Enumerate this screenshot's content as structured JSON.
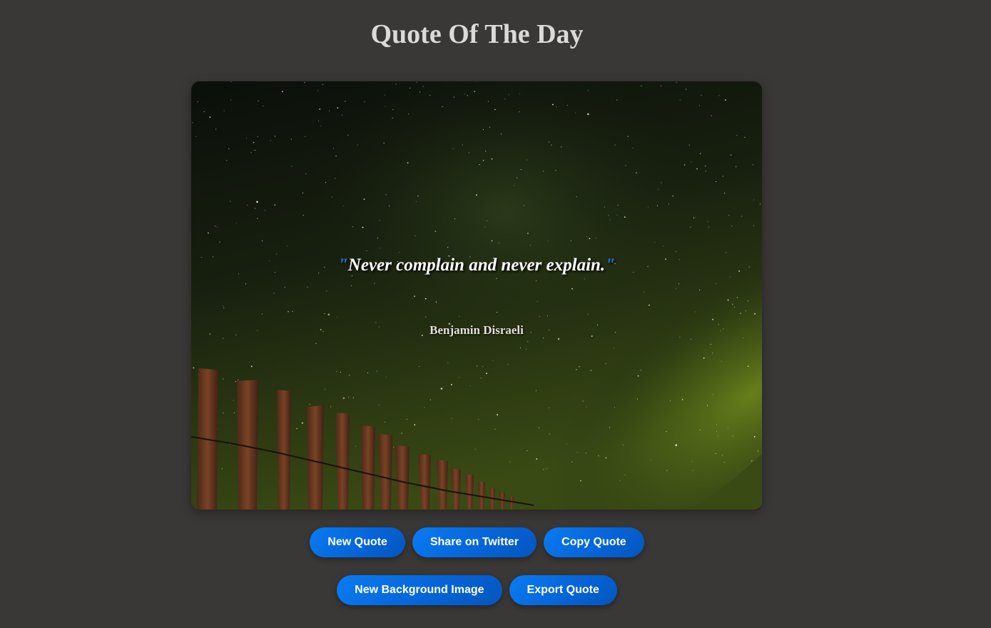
{
  "page": {
    "title": "Quote Of The Day"
  },
  "quote": {
    "open_mark": "\"",
    "text": "Never complain and never explain.",
    "close_mark": "\"",
    "author": "Benjamin Disraeli"
  },
  "buttons": {
    "new_quote": "New Quote",
    "share_twitter": "Share on Twitter",
    "copy_quote": "Copy Quote",
    "new_background": "New Background Image",
    "export_quote": "Export Quote"
  },
  "colors": {
    "page_background": "#393837",
    "accent": "#0a7bf2",
    "title": "#dcdad8"
  }
}
